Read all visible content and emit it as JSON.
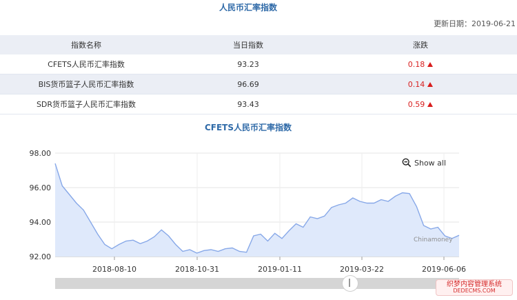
{
  "header": {
    "title": "人民币汇率指数",
    "update_label": "更新日期：2019-06-21"
  },
  "table": {
    "columns": [
      "指数名称",
      "当日指数",
      "涨跌"
    ],
    "rows": [
      {
        "name": "CFETS人民币汇率指数",
        "value": "93.23",
        "change": "0.18"
      },
      {
        "name": "BIS货币篮子人民币汇率指数",
        "value": "96.69",
        "change": "0.14"
      },
      {
        "name": "SDR货币篮子人民币汇率指数",
        "value": "93.43",
        "change": "0.59"
      }
    ]
  },
  "chart": {
    "title": "CFETS人民币汇率指数",
    "show_all_label": "Show all",
    "watermark": "Chinamoney"
  },
  "brand_badge": {
    "line1": "织梦内容管理系统",
    "line2": "DEDECMS.COM"
  },
  "colors": {
    "title_blue": "#2f6aa8",
    "up_red": "#d81e1e",
    "line": "#87a8e8",
    "area": "#dfe9fb"
  },
  "chart_data": {
    "type": "area",
    "y_ticks": [
      "98.00",
      "96.00",
      "94.00",
      "92.00"
    ],
    "x_ticks": [
      "2018-08-10",
      "2018-10-31",
      "2019-01-11",
      "2019-03-22",
      "2019-06-06"
    ],
    "ylim": [
      92,
      98
    ],
    "series": [
      {
        "values": [
          97.4,
          96.1,
          95.6,
          95.1,
          94.7,
          94.0,
          93.3,
          92.7,
          92.45,
          92.7,
          92.9,
          92.95,
          92.75,
          92.9,
          93.15,
          93.55,
          93.2,
          92.7,
          92.3,
          92.4,
          92.2,
          92.35,
          92.4,
          92.3,
          92.45,
          92.5,
          92.3,
          92.25,
          93.2,
          93.3,
          92.9,
          93.35,
          93.05,
          93.5,
          93.9,
          93.7,
          94.3,
          94.2,
          94.35,
          94.85,
          95.0,
          95.1,
          95.4,
          95.2,
          95.1,
          95.1,
          95.3,
          95.2,
          95.5,
          95.7,
          95.65,
          94.9,
          93.8,
          93.6,
          93.7,
          93.2,
          93.05,
          93.23
        ]
      }
    ]
  }
}
